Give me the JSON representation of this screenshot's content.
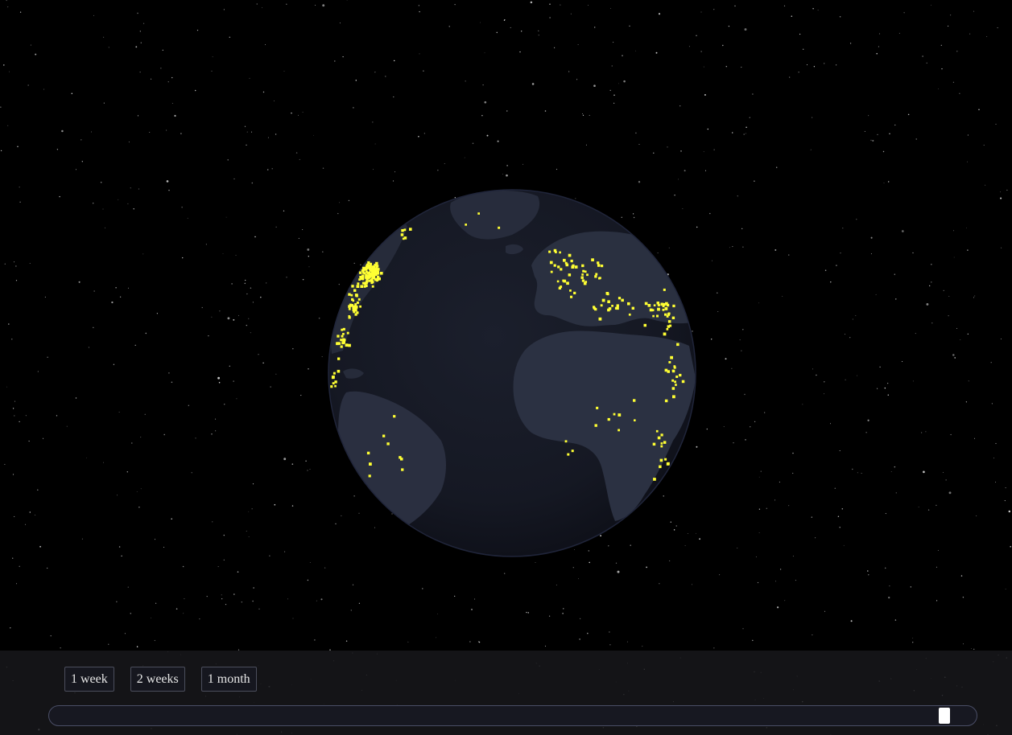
{
  "range_buttons": {
    "week": "1 week",
    "two_weeks": "2 weeks",
    "month": "1 month"
  },
  "timeline_slider": {
    "position": 0.974
  },
  "colors": {
    "space": "#000000",
    "globe_ocean": "#151823",
    "globe_land": "#2b3142",
    "event_dot": "#ffff33",
    "panel": "#18181c",
    "button_border": "#4b4e5c"
  },
  "icons": {
    "event_marker": "yellow-dot-icon",
    "slider_handle": "slider-thumb-icon"
  }
}
